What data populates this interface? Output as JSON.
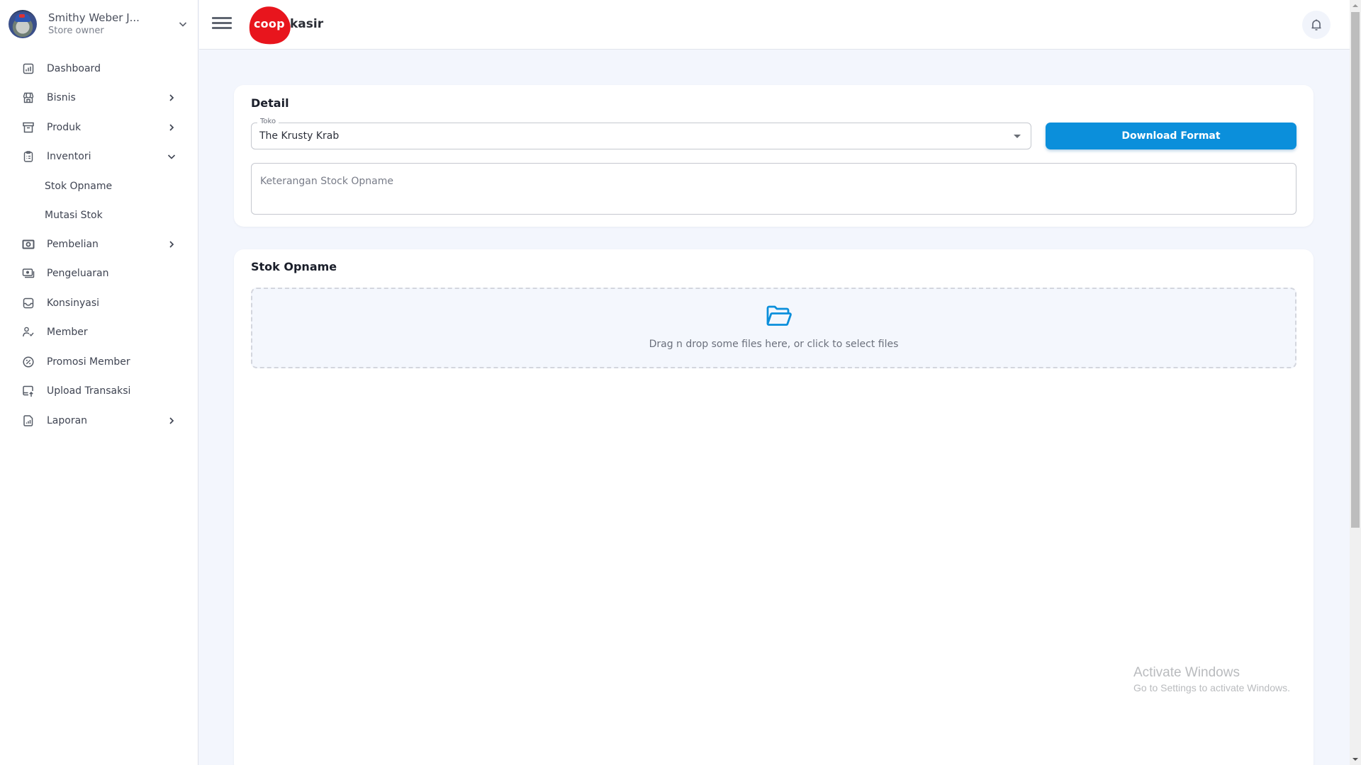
{
  "user": {
    "name": "Smithy Weber J...",
    "role": "Store owner"
  },
  "sidebar": {
    "items": [
      {
        "label": "Dashboard",
        "icon": "bar-chart-icon",
        "expandable": false
      },
      {
        "label": "Bisnis",
        "icon": "store-icon",
        "expandable": true,
        "expanded": false
      },
      {
        "label": "Produk",
        "icon": "archive-box-icon",
        "expandable": true,
        "expanded": false
      },
      {
        "label": "Inventori",
        "icon": "clipboard-list-icon",
        "expandable": true,
        "expanded": true,
        "children": [
          {
            "label": "Stok Opname",
            "active": true
          },
          {
            "label": "Mutasi Stok"
          }
        ]
      },
      {
        "label": "Pembelian",
        "icon": "cash-icon",
        "expandable": true,
        "expanded": false
      },
      {
        "label": "Pengeluaran",
        "icon": "money-stack-icon",
        "expandable": false
      },
      {
        "label": "Konsinyasi",
        "icon": "inbox-icon",
        "expandable": false
      },
      {
        "label": "Member",
        "icon": "user-check-icon",
        "expandable": false
      },
      {
        "label": "Promosi Member",
        "icon": "discount-icon",
        "expandable": false
      },
      {
        "label": "Upload Transaksi",
        "icon": "upload-screen-icon",
        "expandable": false
      },
      {
        "label": "Laporan",
        "icon": "report-icon",
        "expandable": true,
        "expanded": false
      }
    ]
  },
  "topbar": {
    "logo_primary": "coop",
    "logo_secondary": "kasir",
    "brand_color": "#e8151d"
  },
  "detail": {
    "title": "Detail",
    "toko_label": "Toko",
    "toko_value": "The Krusty Krab",
    "download_label": "Download Format",
    "keterangan_placeholder": "Keterangan Stock Opname"
  },
  "stok_opname": {
    "title": "Stok Opname",
    "dropzone_text": "Drag n drop some files here, or click to select files"
  },
  "colors": {
    "accent": "#0b8fdb",
    "background": "#f3f6fd"
  },
  "watermark": {
    "title": "Activate Windows",
    "subtitle": "Go to Settings to activate Windows."
  }
}
